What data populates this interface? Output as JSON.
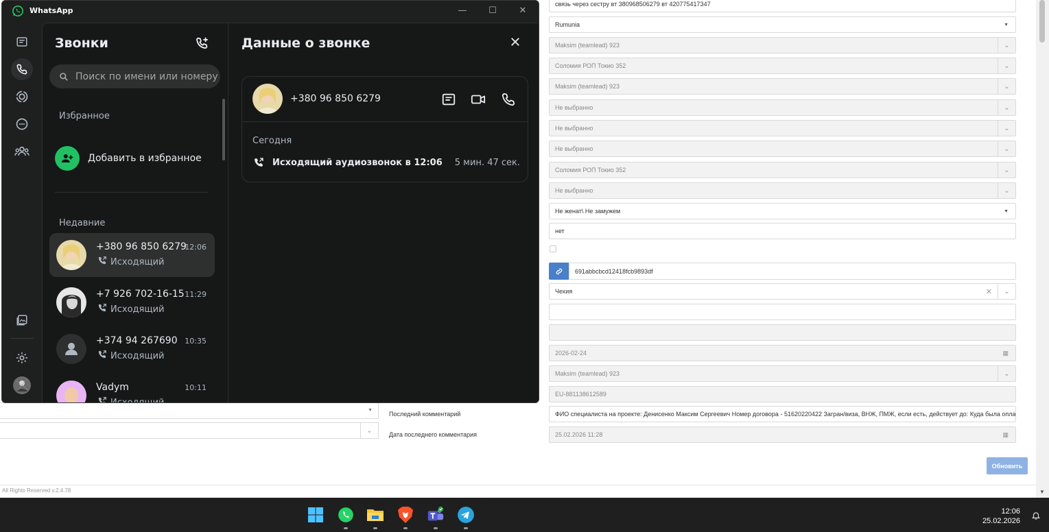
{
  "crm": {
    "fields": [
      {
        "value": "связь через сестру вт 380968506279 вт 420775417347",
        "kind": "text",
        "disabled": false
      },
      {
        "value": "Rumunia",
        "kind": "select",
        "disabled": false
      },
      {
        "value": "Maksim (teamlead) 923",
        "kind": "dropdown",
        "disabled": true
      },
      {
        "value": "Соломия РОП Токио 352",
        "kind": "dropdown",
        "disabled": true
      },
      {
        "value": "Maksim (teamlead) 923",
        "kind": "dropdown",
        "disabled": true
      },
      {
        "value": "Не выбранно",
        "kind": "dropdown",
        "disabled": true
      },
      {
        "value": "Не выбранно",
        "kind": "dropdown",
        "disabled": true
      },
      {
        "value": "Не выбранно",
        "kind": "dropdown",
        "disabled": true
      },
      {
        "value": "Соломия РОП Токио 352",
        "kind": "dropdown",
        "disabled": true
      },
      {
        "value": "Не выбранно",
        "kind": "dropdown",
        "disabled": true
      },
      {
        "value": "Не женат\\ Не замужем",
        "kind": "select",
        "disabled": false
      },
      {
        "value": "нет",
        "kind": "text",
        "disabled": false
      }
    ],
    "link_value": "691abbcbcd12418fcb9893df",
    "country": "Чехия",
    "fields_lower": [
      {
        "value": "",
        "kind": "text",
        "disabled": false
      },
      {
        "value": "",
        "kind": "text",
        "disabled": true
      },
      {
        "value": "2026-02-24",
        "kind": "date",
        "disabled": true
      },
      {
        "value": "Maksim (teamlead) 923",
        "kind": "dropdown",
        "disabled": true
      },
      {
        "value": "EU-881138612589",
        "kind": "text",
        "disabled": true
      },
      {
        "value": "ФИО специалиста на проекте: Денисенко Максим Сергеевич  Номер договора - 51620220422 Загран/виза, ВНЖ, ПМЖ, если есть, действует до: Куда была оплата аванса",
        "kind": "text",
        "disabled": false
      },
      {
        "value": "25.02.2026 11:28",
        "kind": "date",
        "disabled": true
      }
    ],
    "labels": {
      "last_comment": "Последний комментарий",
      "last_comment_date": "Дата последнего комментария"
    },
    "update_button": "Обновить",
    "copyright": "All Rights Reserved v.2.4.78"
  },
  "whatsapp": {
    "app_title": "WhatsApp",
    "calls_title": "Звонки",
    "search_placeholder": "Поиск по имени или номеру",
    "favorites_label": "Избранное",
    "add_favorite": "Добавить в избранное",
    "recent_label": "Недавние",
    "calls": [
      {
        "name": "+380 96 850 6279",
        "time": "12:06",
        "direction": "Исходящий",
        "avatar": "photo-blonde",
        "selected": true
      },
      {
        "name": "+7 926 702-16-15",
        "time": "11:29",
        "direction": "Исходящий",
        "avatar": "photo-bw",
        "selected": false
      },
      {
        "name": "+374 94 267690",
        "time": "10:35",
        "direction": "Исходящий",
        "avatar": "default-person",
        "selected": false
      },
      {
        "name": "Vadym",
        "time": "10:11",
        "direction": "Исходящий",
        "avatar": "photo-pink",
        "selected": false
      }
    ],
    "details": {
      "title": "Данные о звонке",
      "number": "+380 96 850 6279",
      "day": "Сегодня",
      "call_type": "Исходящий аудиозвонок в 12:06",
      "duration": "5 мин. 47 сек."
    },
    "colors": {
      "accent": "#21c063",
      "bg": "#161717",
      "rail": "#1e1f1f"
    }
  },
  "taskbar": {
    "time": "12:06",
    "date": "25.02.2026",
    "apps": [
      "windows-start-icon",
      "whatsapp-icon",
      "file-explorer-icon",
      "brave-browser-icon",
      "teams-icon",
      "telegram-icon"
    ]
  }
}
